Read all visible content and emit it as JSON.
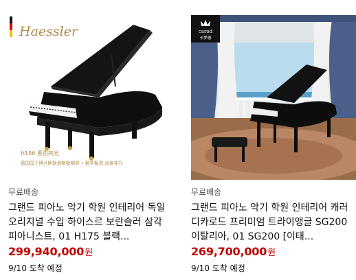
{
  "products": [
    {
      "shipping": "무료배송",
      "title": "그랜드 피아노 악기 학원 인테리어 독일 오리지널 수입 하이스르 보란슬러 삼각 피아니스트, 01 H175 블랙...",
      "price": "299,940,000",
      "currency": "원",
      "delivery": "9/10 도착 예정",
      "image": {
        "brand": "Haessler",
        "model_text": "H186 黑色亮光",
        "slogan": "德国国王博兰斯勒海斯勒钢琴 • 奢华甄选 品鉴非凡"
      }
    },
    {
      "shipping": "무료배송",
      "title": "그랜드 피아노 악기 학원 인테리어 캐러디카로드 프리미엄 트라이앵글 SG200 이탈리아, 01 SG200 [이태...",
      "price": "269,700,000",
      "currency": "원",
      "delivery": "9/10 도착 예정",
      "image": {
        "brand": "carod",
        "brand_sub": "卡罗德"
      }
    }
  ]
}
